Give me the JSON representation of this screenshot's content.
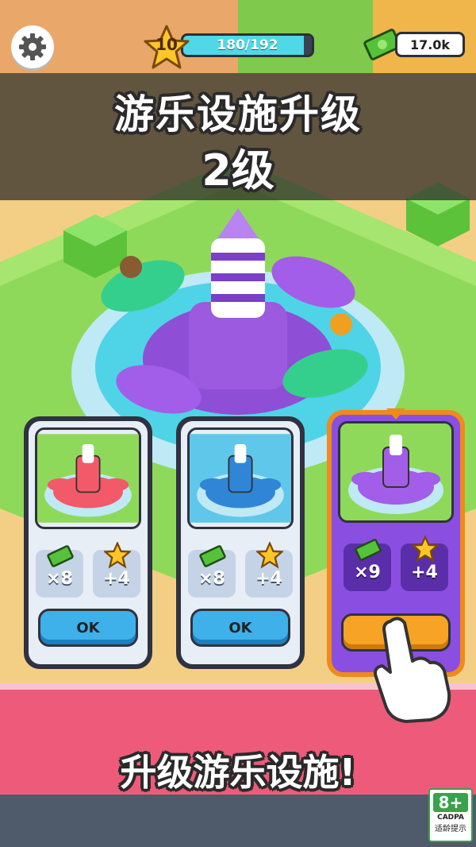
{
  "hud": {
    "level": "10",
    "xp_text": "180/192",
    "xp_fraction": 0.9375,
    "money": "17.0k"
  },
  "banner": {
    "title": "游乐设施升级",
    "level_label": "2级"
  },
  "cards": [
    {
      "cash_reward": "×8",
      "star_reward": "+4",
      "button": "OK",
      "theme": "#f25a6a",
      "selected": false
    },
    {
      "cash_reward": "×8",
      "star_reward": "+4",
      "button": "OK",
      "theme": "#2f86d6",
      "selected": false
    },
    {
      "cash_reward": "×9",
      "star_reward": "+4",
      "button": "OK",
      "theme": "#a25ee8",
      "selected": true
    }
  ],
  "footer": {
    "slogan": "升级游乐设施!"
  },
  "age_rating": {
    "age": "8+",
    "org": "CADPA",
    "tip": "适龄提示"
  },
  "colors": {
    "grass": "#8fd95a",
    "path": "#f3cf86",
    "pink": "#ee5a7a",
    "select_orange": "#f08a1a"
  }
}
